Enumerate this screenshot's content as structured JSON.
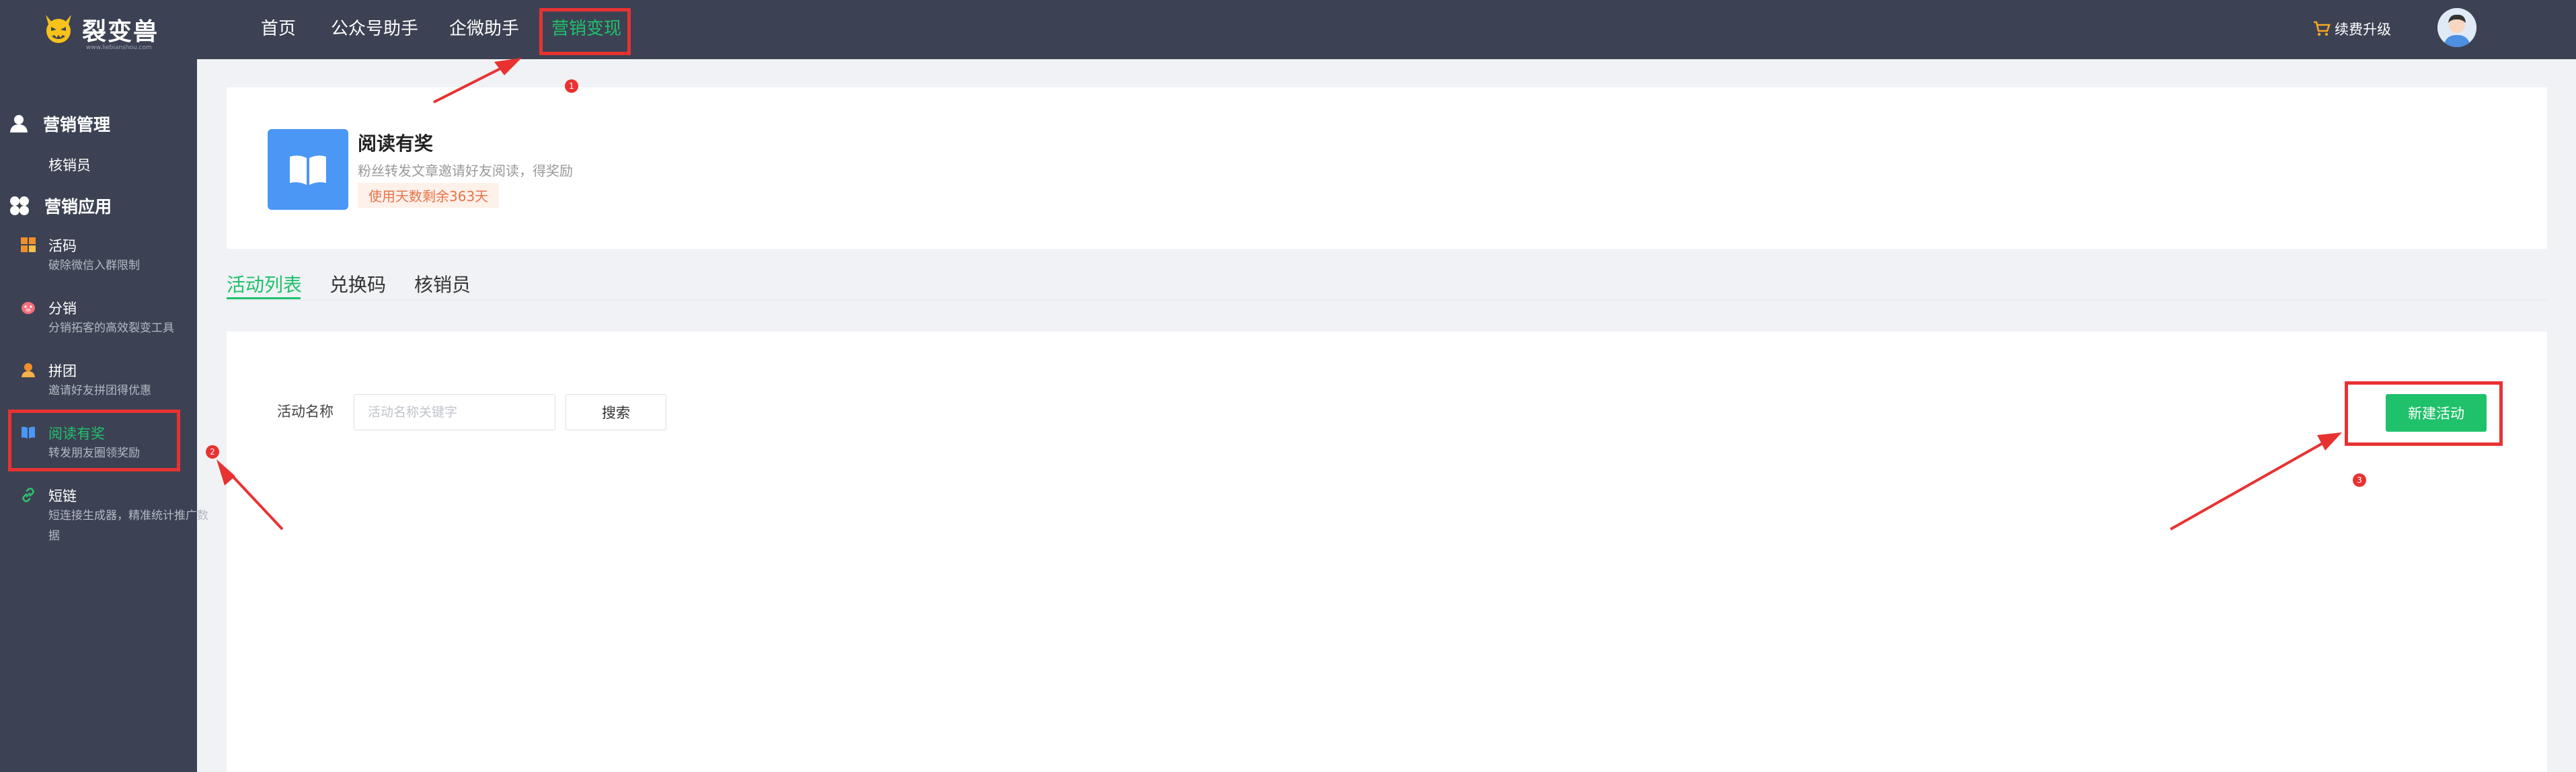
{
  "brand": {
    "name": "裂变兽",
    "sub": "www.liebianshou.com"
  },
  "topnav": {
    "items": [
      "首页",
      "公众号助手",
      "企微助手",
      "营销变现"
    ],
    "upgrade": "续费升级"
  },
  "sidebar": {
    "section1": {
      "title": "营销管理",
      "sub": "核销员"
    },
    "section2": {
      "title": "营销应用"
    },
    "apps": [
      {
        "title": "活码",
        "desc": "破除微信入群限制"
      },
      {
        "title": "分销",
        "desc": "分销拓客的高效裂变工具"
      },
      {
        "title": "拼团",
        "desc": "邀请好友拼团得优惠"
      },
      {
        "title": "阅读有奖",
        "desc": "转发朋友圈领奖励"
      },
      {
        "title": "短链",
        "desc": "短连接生成器，精准统计推广数据"
      }
    ]
  },
  "product": {
    "name": "阅读有奖",
    "desc": "粉丝转发文章邀请好友阅读，得奖励",
    "badge": "使用天数剩余363天"
  },
  "tabs": [
    "活动列表",
    "兑换码",
    "核销员"
  ],
  "filter": {
    "label": "活动名称",
    "placeholder": "活动名称关键字",
    "search": "搜索",
    "new_button": "新建活动"
  },
  "annotations": [
    "1",
    "2",
    "3"
  ],
  "colors": {
    "accent": "#1fc16b",
    "sidebar": "#3c4253",
    "highlight": "#e83232",
    "product_icon": "#4a97f5"
  }
}
